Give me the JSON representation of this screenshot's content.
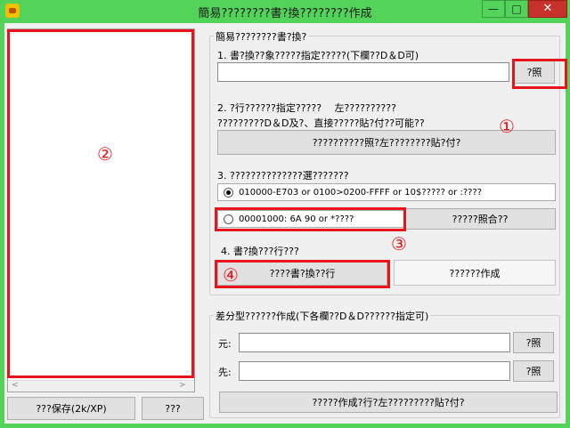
{
  "window": {
    "title": "簡易????????書?換????????作成",
    "minimize_glyph": "—",
    "maximize_glyph": "□",
    "close_glyph": "✕"
  },
  "left": {
    "save_button": "???保存(2k/XP)",
    "small_button": "???",
    "scroll_left": "<",
    "scroll_right": ">"
  },
  "rewrite_group": {
    "legend": "簡易????????書?換?",
    "step1_label": "1. 書?換??象?????指定?????(下欄??D＆D可)",
    "browse1_label": "?照",
    "step2_line1": "2. ?行??????指定?????　 左??????????",
    "step2_line2": "?????????D＆D及?、直接?????貼?付??可能??",
    "paste_button": "??????????照?左????????貼?付?",
    "step3_label": "3. ??????????????選???????",
    "option1_text": "010000-E703 or 0100>0200-FFFF or 10$????? or :????",
    "option2_text": "00001000: 6A 90  or  *????",
    "compare_button": "?????照合??",
    "step4_label": "4. 書?換???行???",
    "execute_button": "????書?換??行",
    "create_button": "??????作成"
  },
  "diff_group": {
    "legend": "差分型??????作成(下各欄??D＆D??????指定可)",
    "source_label": "元:",
    "dest_label": "先:",
    "browse_source": "?照",
    "browse_dest": "?照",
    "create_button": "?????作成?行?左?????????貼?付?"
  },
  "annotations": {
    "m1": "①",
    "m2": "②",
    "m3": "③",
    "m4": "④"
  },
  "colors": {
    "titlebar": "#54d35b",
    "close": "#c7312b",
    "annotation_red": "#e8141c"
  }
}
